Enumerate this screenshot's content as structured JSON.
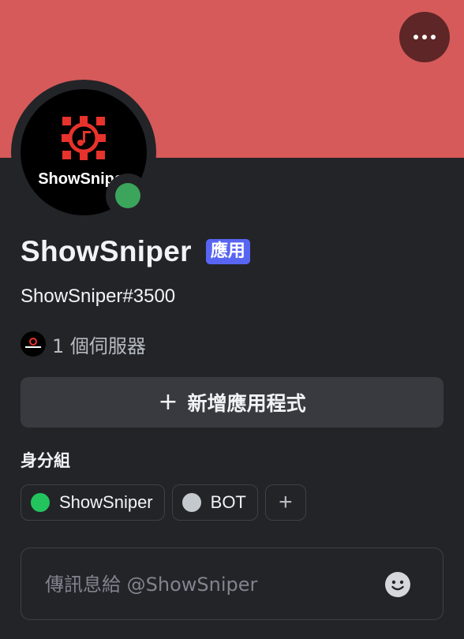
{
  "profile": {
    "banner_color": "#d65a5a",
    "avatar_logo_text": "ShowSniper",
    "status": "online",
    "display_name": "ShowSniper",
    "app_badge": "應用",
    "username": "ShowSniper#3500",
    "server_count": "1 個伺服器"
  },
  "actions": {
    "more_icon": "more-horizontal-icon",
    "add_app_label": "新增應用程式",
    "add_app_icon": "plus-icon"
  },
  "roles": {
    "heading": "身分組",
    "items": [
      {
        "label": "ShowSniper",
        "color": "#23c45e"
      },
      {
        "label": "BOT",
        "color": "#c4c9ce"
      }
    ],
    "add_icon": "plus-icon"
  },
  "message": {
    "placeholder": "傳訊息給 @ShowSniper",
    "emoji_icon": "smiley-icon"
  },
  "colors": {
    "background": "#232428",
    "accent": "#5865f2",
    "status_online": "#3ba55c"
  }
}
